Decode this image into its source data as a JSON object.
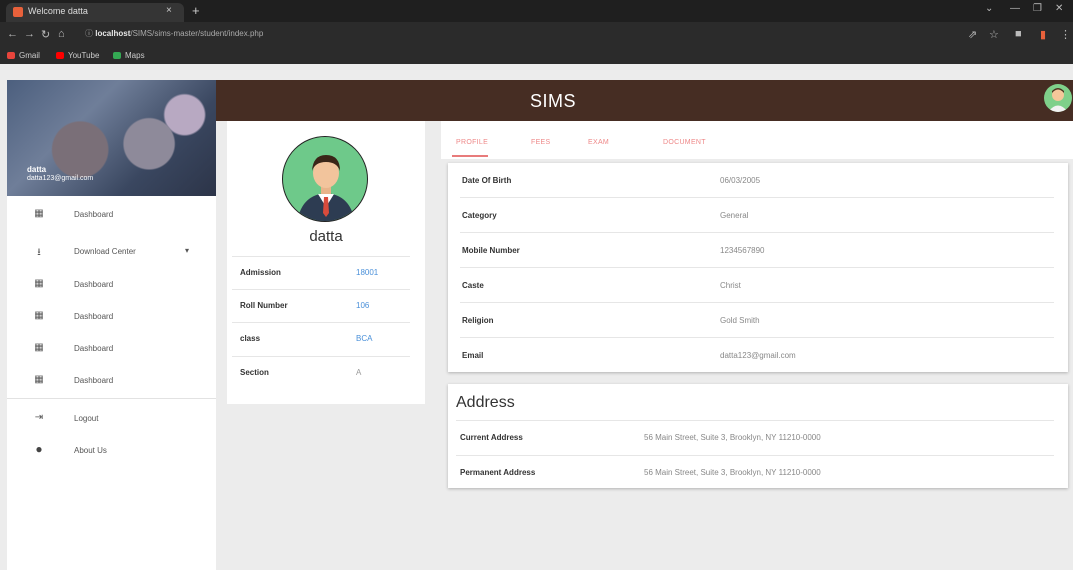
{
  "browser": {
    "tab_title": "Welcome datta",
    "tab_close": "×",
    "new_tab": "+",
    "url_host": "localhost",
    "url_path": "/SIMS/sims-master/student/index.php",
    "bookmarks": [
      "Gmail",
      "YouTube",
      "Maps"
    ],
    "bookmark_colors": [
      "#e8453c",
      "#ff0000",
      "#34a853"
    ]
  },
  "app": {
    "title": "SIMS",
    "brand_color": "#462d23",
    "accent_color": "#e87b7b"
  },
  "sidebar": {
    "user_name": "datta",
    "user_email": "datta123@gmail.com",
    "items": [
      {
        "label": "Dashboard",
        "icon": "grid-icon"
      },
      {
        "label": "Download Center",
        "icon": "download-icon",
        "has_caret": true
      },
      {
        "label": "Dashboard",
        "icon": "grid-icon"
      },
      {
        "label": "Dashboard",
        "icon": "grid-icon"
      },
      {
        "label": "Dashboard",
        "icon": "grid-icon"
      },
      {
        "label": "Dashboard",
        "icon": "grid-icon"
      },
      {
        "label": "Logout",
        "icon": "logout-icon"
      },
      {
        "label": "About Us",
        "icon": "info-icon"
      }
    ]
  },
  "profile": {
    "name": "datta",
    "rows": [
      {
        "key": "Admission",
        "value": "18001"
      },
      {
        "key": "Roll Number",
        "value": "106"
      },
      {
        "key": "class",
        "value": "BCA"
      },
      {
        "key": "Section",
        "value": "A"
      }
    ]
  },
  "tabs": [
    "PROFILE",
    "FEES",
    "EXAM",
    "DOCUMENT"
  ],
  "details": [
    {
      "key": "Date Of Birth",
      "value": "06/03/2005"
    },
    {
      "key": "Category",
      "value": "General"
    },
    {
      "key": "Mobile Number",
      "value": "1234567890"
    },
    {
      "key": "Caste",
      "value": "Christ"
    },
    {
      "key": "Religion",
      "value": "Gold Smith"
    },
    {
      "key": "Email",
      "value": "datta123@gmail.com"
    }
  ],
  "address": {
    "title": "Address",
    "rows": [
      {
        "key": "Current Address",
        "value": "56 Main Street, Suite 3, Brooklyn, NY 11210-0000"
      },
      {
        "key": "Permanent Address",
        "value": "56 Main Street, Suite 3, Brooklyn, NY 11210-0000"
      }
    ]
  }
}
